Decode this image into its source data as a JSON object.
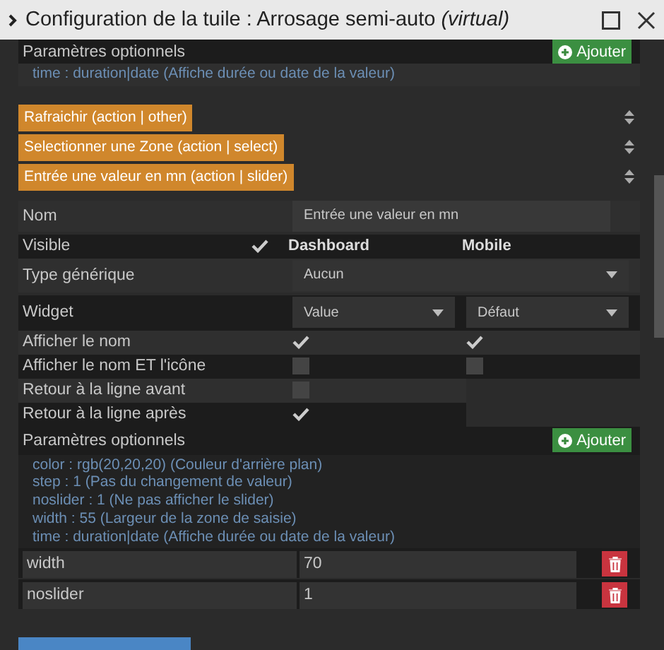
{
  "window": {
    "title": "Configuration de la tuile : Arrosage semi-auto *(virtual)*"
  },
  "top_params": {
    "title": "Paramètres optionnels",
    "button": "Ajouter",
    "hints": [
      "time : duration|date (Affiche durée ou date de la valeur)"
    ]
  },
  "commands": [
    {
      "label": "Rafraichir (action | other)",
      "color": "#d0872c",
      "expanded": false
    },
    {
      "label": "Selectionner une Zone (action | select)",
      "color": "#d0872c",
      "expanded": false
    },
    {
      "label": "Entrée une valeur en mn (action | slider)",
      "color": "#d0872c",
      "expanded": true
    }
  ],
  "detail": {
    "name_label": "Nom",
    "name_value": "Entrée une valeur en mn",
    "visible_label": "Visible",
    "visible": true,
    "columns": [
      "Dashboard",
      "Mobile"
    ],
    "generic_label": "Type générique",
    "generic_value": "Aucun",
    "widget_label": "Widget",
    "widget_dashboard": "Value",
    "widget_mobile": "Défaut",
    "options": [
      {
        "label": "Afficher le nom",
        "dashboard": true,
        "mobile": true
      },
      {
        "label": "Afficher le nom ET l'icône",
        "dashboard": false,
        "mobile": false
      },
      {
        "label": "Retour à la ligne avant",
        "dashboard": false
      },
      {
        "label": "Retour à la ligne après",
        "dashboard": true
      }
    ],
    "params": {
      "title": "Paramètres optionnels",
      "button": "Ajouter",
      "hints": [
        "color : rgb(20,20,20) (Couleur d'arrière plan)",
        "step : 1 (Pas du changement de valeur)",
        "noslider : 1 (Ne pas afficher le slider)",
        "width : 55 (Largeur de la zone de saisie)",
        "time : duration|date (Affiche durée ou date de la valeur)"
      ],
      "entries": [
        {
          "key": "width",
          "value": "70"
        },
        {
          "key": "noslider",
          "value": "1"
        }
      ]
    }
  },
  "next_command": {
    "color": "#4a86c5"
  }
}
